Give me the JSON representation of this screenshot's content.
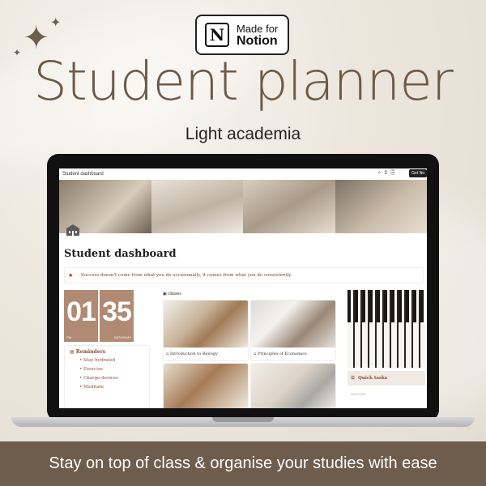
{
  "badge": {
    "line1": "Made for",
    "line2": "Notion",
    "logo_letter": "N",
    "icon": "notion-logo-icon"
  },
  "title": "Student planner",
  "subtitle": "Light academia",
  "footer": "Stay on top of class & organise your studies with ease",
  "colors": {
    "brand_brown": "#6e5c4d",
    "accent_rust": "#8a4c35",
    "clock_tan": "#b08a72"
  },
  "app": {
    "tab_title": "Student dashboard",
    "top_icons": [
      "search-icon",
      "share-icon",
      "export-icon",
      "more-icon"
    ],
    "get_button": "Get No",
    "page_title": "Student dashboard",
    "quote": "- Success doesn't come from what you do occasionally, it comes from what you do consistently.",
    "clock": {
      "hours": "01",
      "minutes": "35",
      "period": "PM",
      "day": "SATURDAY"
    },
    "reminders": {
      "heading": "Reminders",
      "items": [
        "Stay hydrated",
        "Exercise",
        "Charge devices",
        "Meditate"
      ]
    },
    "classes": {
      "label": "classes",
      "cards": [
        {
          "caption": "Introduction to Biology"
        },
        {
          "caption": "Principles of Economics"
        },
        {
          "caption": ""
        },
        {
          "caption": ""
        }
      ]
    },
    "quick_tasks": {
      "heading": "Quick tasks",
      "new_task": "New task"
    }
  }
}
